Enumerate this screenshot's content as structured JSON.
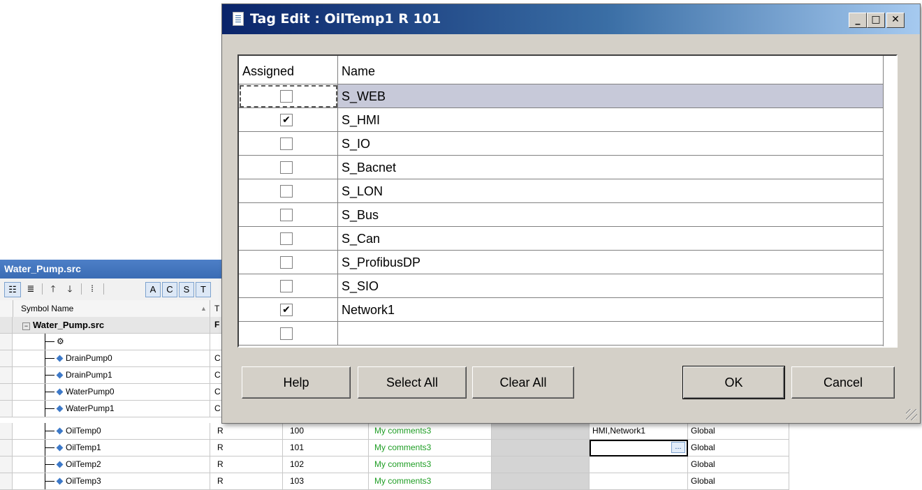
{
  "source_window": {
    "title": "Water_Pump.src",
    "toolbar": [
      "A",
      "C",
      "S",
      "T"
    ],
    "columns": {
      "symbol_name": "Symbol Name",
      "type": "T"
    },
    "root": {
      "name": "Water_Pump.src",
      "type": "F"
    },
    "rows": [
      {
        "name": "DrainPump0",
        "type": "C"
      },
      {
        "name": "DrainPump1",
        "type": "C"
      },
      {
        "name": "WaterPump0",
        "type": "C"
      },
      {
        "name": "WaterPump1",
        "type": "C"
      },
      {
        "name": "OilTemp0",
        "type": "R",
        "address": "100",
        "comment": "My comments3",
        "network": "HMI,Network1",
        "scope": "Global"
      },
      {
        "name": "OilTemp1",
        "type": "R",
        "address": "101",
        "comment": "My comments3",
        "network": "",
        "scope": "Global"
      },
      {
        "name": "OilTemp2",
        "type": "R",
        "address": "102",
        "comment": "My comments3",
        "network": "",
        "scope": "Global"
      },
      {
        "name": "OilTemp3",
        "type": "R",
        "address": "103",
        "comment": "My comments3",
        "network": "",
        "scope": "Global"
      }
    ],
    "ellipsis": "..."
  },
  "dialog": {
    "title": "Tag Edit : OilTemp1 R 101",
    "caption_buttons": {
      "minimize": "_",
      "maximize": "□",
      "close": "✕"
    },
    "columns": {
      "assigned": "Assigned",
      "name": "Name"
    },
    "items": [
      {
        "name": "S_WEB",
        "assigned": false,
        "mark": ""
      },
      {
        "name": "S_HMI",
        "assigned": true,
        "mark": "✔"
      },
      {
        "name": "S_IO",
        "assigned": false,
        "mark": ""
      },
      {
        "name": "S_Bacnet",
        "assigned": false,
        "mark": ""
      },
      {
        "name": "S_LON",
        "assigned": false,
        "mark": ""
      },
      {
        "name": "S_Bus",
        "assigned": false,
        "mark": ""
      },
      {
        "name": "S_Can",
        "assigned": false,
        "mark": ""
      },
      {
        "name": "S_ProfibusDP",
        "assigned": false,
        "mark": ""
      },
      {
        "name": "S_SIO",
        "assigned": false,
        "mark": ""
      },
      {
        "name": "Network1",
        "assigned": true,
        "mark": "✔"
      },
      {
        "name": "",
        "assigned": false,
        "mark": ""
      }
    ],
    "buttons": {
      "help": "Help",
      "select_all": "Select All",
      "clear_all": "Clear All",
      "ok": "OK",
      "cancel": "Cancel"
    }
  }
}
